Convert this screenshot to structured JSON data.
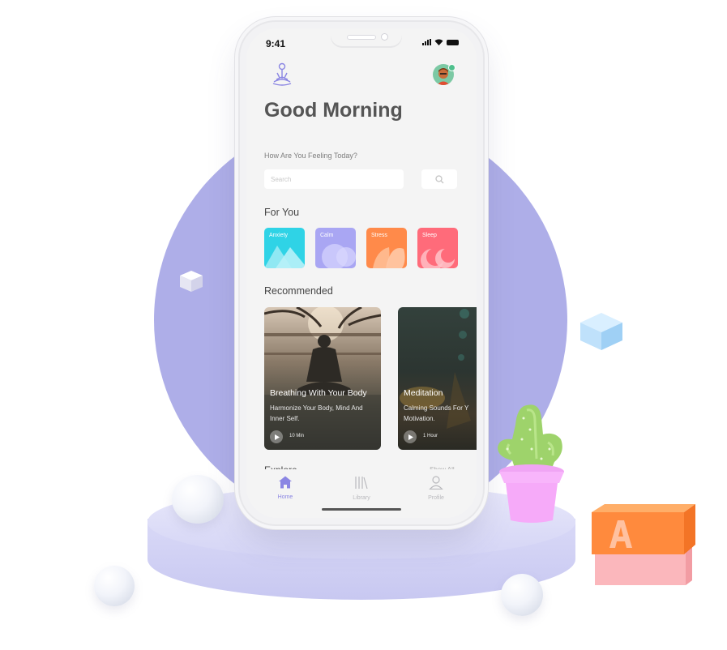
{
  "status_bar": {
    "time": "9:41"
  },
  "header": {
    "greeting": "Good Morning",
    "subtitle": "How Are You Feeling Today?"
  },
  "search": {
    "placeholder": "Search"
  },
  "for_you": {
    "title": "For You",
    "moods": [
      {
        "label": "Anxiety",
        "color": "#2fd3e6"
      },
      {
        "label": "Calm",
        "color": "#a9a6f3"
      },
      {
        "label": "Stress",
        "color": "#ff8a4a"
      },
      {
        "label": "Sleep",
        "color": "#ff6b7a"
      }
    ]
  },
  "recommended": {
    "title": "Recommended",
    "cards": [
      {
        "title": "Breathing With Your Body",
        "description": "Harmonize Your Body, Mind And Inner Self.",
        "duration": "10 Min"
      },
      {
        "title": "Meditation",
        "description": "Calming Sounds For Y Motivation.",
        "duration": "1 Hour"
      }
    ]
  },
  "explore": {
    "title": "Explore",
    "show_all": "Show All"
  },
  "tabs": [
    {
      "label": "Home",
      "icon": "home-icon",
      "active": true
    },
    {
      "label": "Library",
      "icon": "library-icon",
      "active": false
    },
    {
      "label": "Profile",
      "icon": "profile-icon",
      "active": false
    }
  ],
  "decor": {
    "block_letter": "A"
  },
  "colors": {
    "accent": "#8b86e3",
    "circle": "#aeaee8",
    "podium": "#d6d6f6"
  }
}
